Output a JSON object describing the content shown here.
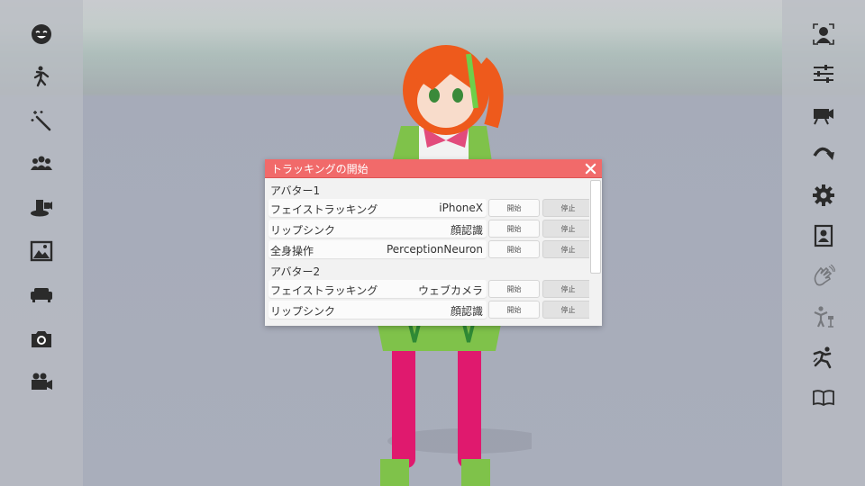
{
  "left_toolbar": {
    "items": [
      {
        "icon": "face-icon"
      },
      {
        "icon": "pose-icon"
      },
      {
        "icon": "magic-wand-icon"
      },
      {
        "icon": "group-icon"
      },
      {
        "icon": "stage-camera-icon"
      },
      {
        "icon": "image-icon"
      },
      {
        "icon": "sofa-icon"
      },
      {
        "icon": "photo-camera-icon"
      },
      {
        "icon": "video-camera-icon"
      }
    ]
  },
  "right_toolbar": {
    "items": [
      {
        "icon": "face-tracking-icon"
      },
      {
        "icon": "sliders-icon"
      },
      {
        "icon": "camera-switch-icon"
      },
      {
        "icon": "redo-arrow-icon"
      },
      {
        "icon": "gear-icon"
      },
      {
        "icon": "portrait-frame-icon"
      },
      {
        "icon": "hand-wave-icon",
        "disabled": true
      },
      {
        "icon": "body-tracking-icon",
        "disabled": true
      },
      {
        "icon": "motion-icon"
      },
      {
        "icon": "book-icon"
      }
    ]
  },
  "dialog": {
    "title": "トラッキングの開始",
    "close_icon": "close-icon",
    "header_color": "#f16a6a",
    "sections": [
      {
        "label": "アバター1",
        "rows": [
          {
            "label": "フェイストラッキング",
            "device": "iPhoneX",
            "start": "開始",
            "stop": "停止"
          },
          {
            "label": "リップシンク",
            "device": "顔認識",
            "start": "開始",
            "stop": "停止"
          },
          {
            "label": "全身操作",
            "device": "PerceptionNeuron",
            "start": "開始",
            "stop": "停止"
          }
        ]
      },
      {
        "label": "アバター2",
        "rows": [
          {
            "label": "フェイストラッキング",
            "device": "ウェブカメラ",
            "start": "開始",
            "stop": "停止"
          },
          {
            "label": "リップシンク",
            "device": "顔認識",
            "start": "開始",
            "stop": "停止"
          }
        ]
      }
    ]
  }
}
